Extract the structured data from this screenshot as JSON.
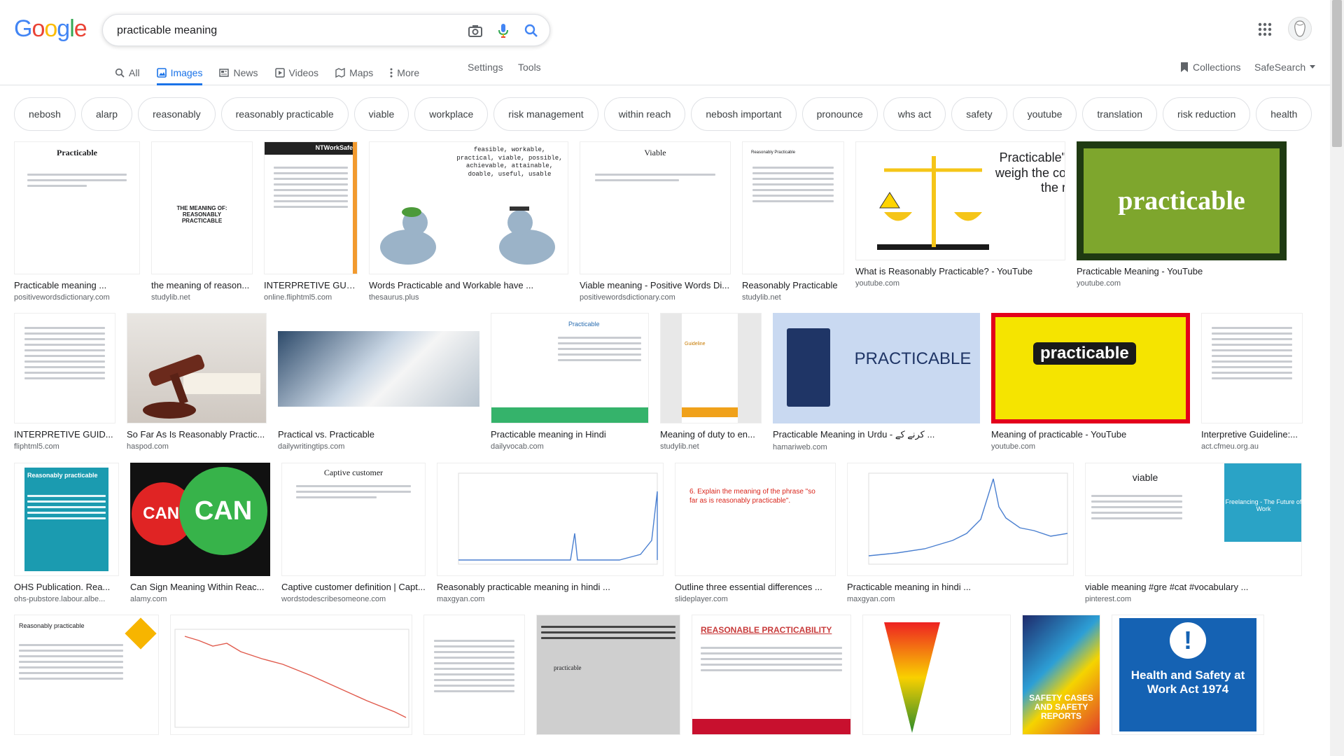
{
  "logo_text": "Google",
  "colors": {
    "blue": "#4285f4",
    "red": "#ea4335",
    "yellow": "#fbbc05",
    "green": "#34a853",
    "accent": "#1a73e8"
  },
  "search": {
    "query": "practicable meaning"
  },
  "tabs": [
    {
      "label": "All",
      "icon": "search-icon",
      "active": false
    },
    {
      "label": "Images",
      "icon": "image-icon",
      "active": true
    },
    {
      "label": "News",
      "icon": "news-icon",
      "active": false
    },
    {
      "label": "Videos",
      "icon": "play-icon",
      "active": false
    },
    {
      "label": "Maps",
      "icon": "map-icon",
      "active": false
    },
    {
      "label": "More",
      "icon": "dots-vertical-icon",
      "active": false
    }
  ],
  "tools": {
    "settings": "Settings",
    "tools": "Tools"
  },
  "right": {
    "collections": "Collections",
    "safesearch": "SafeSearch"
  },
  "chips": [
    "nebosh",
    "alarp",
    "reasonably",
    "reasonably practicable",
    "viable",
    "workplace",
    "risk management",
    "within reach",
    "nebosh important",
    "pronounce",
    "whs act",
    "safety",
    "youtube",
    "translation",
    "risk reduction",
    "health"
  ],
  "rows": [
    [
      {
        "caption": "Practicable meaning ...",
        "source": "positivewordsdictionary.com",
        "thumb_text": "Practicable"
      },
      {
        "caption": "the meaning of reason...",
        "source": "studylib.net",
        "thumb_text": "THE MEANING OF: REASONABLY PRACTICABLE"
      },
      {
        "caption": "INTERPRETIVE GUID...",
        "source": "online.fliphtml5.com",
        "thumb_text": "NTWorkSafe"
      },
      {
        "caption": "Words Practicable and Workable have ...",
        "source": "thesaurus.plus",
        "thumb_text": "feasible, workable, practical, viable, possible, achievable, attainable, doable, useful, usable"
      },
      {
        "caption": "Viable meaning - Positive Words Di...",
        "source": "positivewordsdictionary.com",
        "thumb_text": "Viable"
      },
      {
        "caption": "Reasonably Practicable",
        "source": "studylib.net",
        "thumb_text": "Reasonably Practicable"
      },
      {
        "caption": "What is Reasonably Practicable? - YouTube",
        "source": "youtube.com",
        "thumb_text": "Practicable\" weigh the co the r"
      },
      {
        "caption": "Practicable Meaning - YouTube",
        "source": "youtube.com",
        "thumb_text": "practicable"
      }
    ],
    [
      {
        "caption": "INTERPRETIVE GUID...",
        "source": "fliphtml5.com",
        "thumb_text": ""
      },
      {
        "caption": "So Far As Is Reasonably Practic...",
        "source": "haspod.com",
        "thumb_text": ""
      },
      {
        "caption": "Practical vs. Practicable",
        "source": "dailywritingtips.com",
        "thumb_text": ""
      },
      {
        "caption": "Practicable meaning in Hindi",
        "source": "dailyvocab.com",
        "thumb_text": "Practicable"
      },
      {
        "caption": "Meaning of duty to en...",
        "source": "studylib.net",
        "thumb_text": "Guideline"
      },
      {
        "caption": "Practicable Meaning in Urdu - کرنے کے ...",
        "source": "hamariweb.com",
        "thumb_text": "PRACTICABLE"
      },
      {
        "caption": "Meaning of practicable - YouTube",
        "source": "youtube.com",
        "thumb_text": "practicable"
      },
      {
        "caption": "Interpretive Guideline:...",
        "source": "act.cfmeu.org.au",
        "thumb_text": ""
      }
    ],
    [
      {
        "caption": "OHS Publication. Rea...",
        "source": "ohs-pubstore.labour.albe...",
        "thumb_text": "Reasonably practicable"
      },
      {
        "caption": "Can Sign Meaning Within Reac...",
        "source": "alamy.com",
        "thumb_text": "CAN'"
      },
      {
        "caption": "Captive customer definition | Capt...",
        "source": "wordstodescribesomeone.com",
        "thumb_text": "Captive customer"
      },
      {
        "caption": "Reasonably practicable meaning in hindi ...",
        "source": "maxgyan.com",
        "thumb_text": ""
      },
      {
        "caption": "Outline three essential differences ...",
        "source": "slideplayer.com",
        "thumb_text": "6. Explain the meaning of the phrase \"so far as is reasonably practicable\"."
      },
      {
        "caption": "Practicable meaning in hindi ...",
        "source": "maxgyan.com",
        "thumb_text": ""
      },
      {
        "caption": "viable meaning #gre #cat #vocabulary ...",
        "source": "pinterest.com",
        "thumb_text": "viable"
      }
    ],
    [
      {
        "caption": "",
        "source": "",
        "thumb_text": "Reasonably practicable"
      },
      {
        "caption": "",
        "source": "",
        "thumb_text": ""
      },
      {
        "caption": "",
        "source": "",
        "thumb_text": ""
      },
      {
        "caption": "",
        "source": "",
        "thumb_text": "practicable"
      },
      {
        "caption": "",
        "source": "",
        "thumb_text": "REASONABLE PRACTICABILITY"
      },
      {
        "caption": "",
        "source": "",
        "thumb_text": ""
      },
      {
        "caption": "",
        "source": "",
        "thumb_text": "SAFETY CASES AND SAFETY REPORTS"
      },
      {
        "caption": "",
        "source": "",
        "thumb_text": "Health and Safety at Work Act 1974"
      }
    ]
  ]
}
